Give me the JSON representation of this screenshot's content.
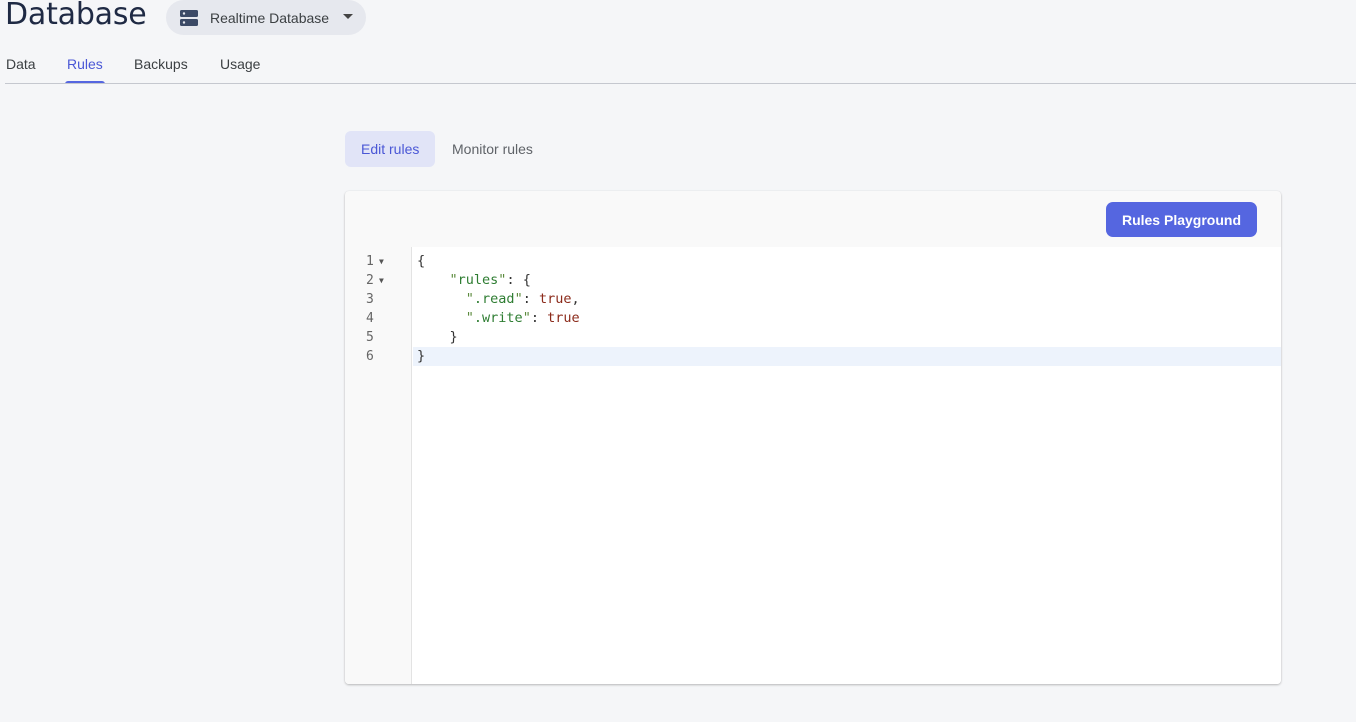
{
  "header": {
    "title": "Database",
    "db_selector": {
      "label": "Realtime Database",
      "icon": "database-icon"
    }
  },
  "tabs": [
    {
      "label": "Data",
      "active": false
    },
    {
      "label": "Rules",
      "active": true
    },
    {
      "label": "Backups",
      "active": false
    },
    {
      "label": "Usage",
      "active": false
    }
  ],
  "subtabs": [
    {
      "label": "Edit rules",
      "active": true
    },
    {
      "label": "Monitor rules",
      "active": false
    }
  ],
  "toolbar": {
    "playground_label": "Rules Playground"
  },
  "editor": {
    "line_numbers": [
      "1",
      "2",
      "3",
      "4",
      "5",
      "6"
    ],
    "current_line": "6",
    "code": {
      "l1": "{",
      "l2_key": "rules",
      "l2_rest": ": {",
      "l3_key": ".read",
      "l3_val": "true",
      "l3_tail": ",",
      "l4_key": ".write",
      "l4_val": "true",
      "l5": "}",
      "l6": "}"
    }
  },
  "colors": {
    "accent": "#5566e0",
    "active_text": "#4a57d6",
    "string": "#2e7d32",
    "boolean": "#8b2a1a"
  }
}
